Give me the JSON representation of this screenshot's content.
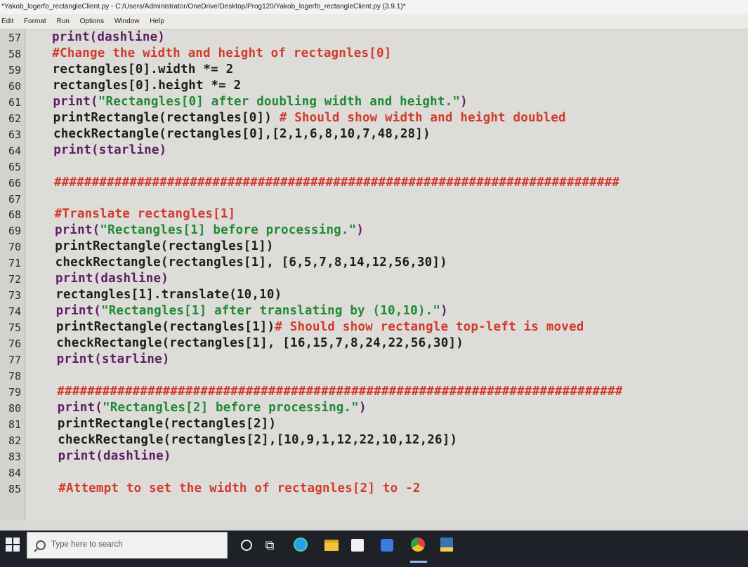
{
  "window": {
    "title": "*Yakob_logerfo_rectangleClient.py - C:/Users/Administrator/OneDrive/Desktop/Prog120/Yakob_logerfo_rectangleClient.py (3.9.1)*"
  },
  "menu": [
    "Edit",
    "Format",
    "Run",
    "Options",
    "Window",
    "Help"
  ],
  "editor": {
    "lines": [
      {
        "num": "57",
        "tokens": [
          [
            "call",
            "print(dashline)"
          ]
        ]
      },
      {
        "num": "58",
        "tokens": [
          [
            "comment",
            "#Change the width and height of rectagnles[0]"
          ]
        ]
      },
      {
        "num": "59",
        "tokens": [
          [
            "plain",
            "rectangles[0].width *= 2"
          ]
        ]
      },
      {
        "num": "60",
        "tokens": [
          [
            "plain",
            "rectangles[0].height *= 2"
          ]
        ]
      },
      {
        "num": "61",
        "tokens": [
          [
            "call",
            "print("
          ],
          [
            "string",
            "\"Rectangles[0] after doubling width and height.\""
          ],
          [
            "call",
            ")"
          ]
        ]
      },
      {
        "num": "62",
        "tokens": [
          [
            "plain",
            "printRectangle(rectangles[0]) "
          ],
          [
            "comment",
            "# Should show width and height doubled"
          ]
        ]
      },
      {
        "num": "63",
        "tokens": [
          [
            "plain",
            "checkRectangle(rectangles[0],[2,1,6,8,10,7,48,28])"
          ]
        ]
      },
      {
        "num": "64",
        "tokens": [
          [
            "call",
            "print(starline)"
          ]
        ]
      },
      {
        "num": "65",
        "tokens": []
      },
      {
        "num": "66",
        "tokens": [
          [
            "comment",
            "###########################################################################"
          ]
        ]
      },
      {
        "num": "67",
        "tokens": []
      },
      {
        "num": "68",
        "tokens": [
          [
            "comment",
            "#Translate rectangles[1]"
          ]
        ]
      },
      {
        "num": "69",
        "tokens": [
          [
            "call",
            "print("
          ],
          [
            "string",
            "\"Rectangles[1] before processing.\""
          ],
          [
            "call",
            ")"
          ]
        ]
      },
      {
        "num": "70",
        "tokens": [
          [
            "plain",
            "printRectangle(rectangles[1])"
          ]
        ]
      },
      {
        "num": "71",
        "tokens": [
          [
            "plain",
            "checkRectangle(rectangles[1], [6,5,7,8,14,12,56,30])"
          ]
        ]
      },
      {
        "num": "72",
        "tokens": [
          [
            "call",
            "print(dashline)"
          ]
        ]
      },
      {
        "num": "73",
        "tokens": [
          [
            "plain",
            "rectangles[1].translate(10,10)"
          ]
        ]
      },
      {
        "num": "74",
        "tokens": [
          [
            "call",
            "print("
          ],
          [
            "string",
            "\"Rectangles[1] after translating by (10,10).\""
          ],
          [
            "call",
            ")"
          ]
        ]
      },
      {
        "num": "75",
        "tokens": [
          [
            "plain",
            "printRectangle(rectangles[1])"
          ],
          [
            "comment",
            "# Should show rectangle top-left is moved"
          ]
        ]
      },
      {
        "num": "76",
        "tokens": [
          [
            "plain",
            "checkRectangle(rectangles[1], [16,15,7,8,24,22,56,30])"
          ]
        ]
      },
      {
        "num": "77",
        "tokens": [
          [
            "call",
            "print(starline)"
          ]
        ]
      },
      {
        "num": "78",
        "tokens": []
      },
      {
        "num": "79",
        "tokens": [
          [
            "comment",
            "###########################################################################"
          ]
        ]
      },
      {
        "num": "80",
        "tokens": [
          [
            "call",
            "print("
          ],
          [
            "string",
            "\"Rectangles[2] before processing.\""
          ],
          [
            "call",
            ")"
          ]
        ]
      },
      {
        "num": "81",
        "tokens": [
          [
            "plain",
            "printRectangle(rectangles[2])"
          ]
        ]
      },
      {
        "num": "82",
        "tokens": [
          [
            "plain",
            "checkRectangle(rectangles[2],[10,9,1,12,22,10,12,26])"
          ]
        ]
      },
      {
        "num": "83",
        "tokens": [
          [
            "call",
            "print(dashline)"
          ]
        ]
      },
      {
        "num": "84",
        "tokens": []
      },
      {
        "num": "85",
        "tokens": [
          [
            "comment",
            "#Attempt to set the width of rectagnles[2] to -2"
          ]
        ]
      }
    ]
  },
  "taskbar": {
    "search_placeholder": "Type here to search"
  },
  "colors": {
    "comment": "#d33a2a",
    "string": "#1e8a33",
    "call": "#5c1f63",
    "plain": "#1c1c1c"
  }
}
